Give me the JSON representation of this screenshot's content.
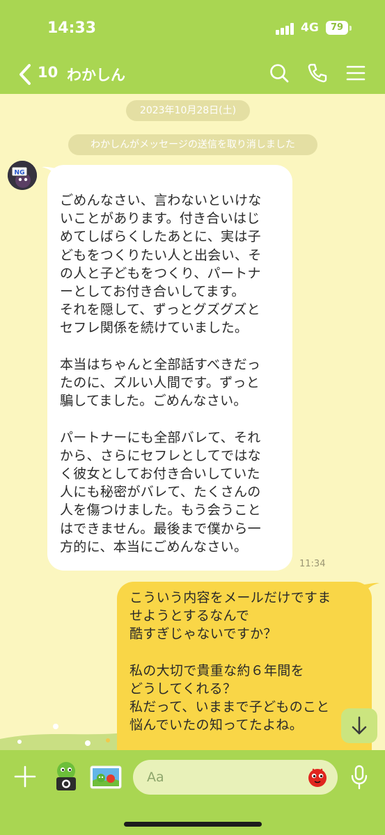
{
  "status_bar": {
    "time": "14:33",
    "network": "4G",
    "battery": "79"
  },
  "header": {
    "back_count": "10",
    "title": "わかしん"
  },
  "system_messages": {
    "date": "2023年10月28日(土)",
    "unsend_notice": "わかしんがメッセージの送信を取り消しました"
  },
  "incoming_message": {
    "avatar_badge": "NG",
    "paragraphs": [
      "ごめんなさい、言わないといけな\nいことがあります。付き合いはじ\nめてしばらくしたあとに、実は子\nどもをつくりたい人と出会い、そ\nの人と子どもをつくり、パートナ\nーとしてお付き合いしてます。\nそれを隠して、ずっとグズグズと\nセフレ関係を続けていました。",
      "本当はちゃんと全部話すべきだっ\nたのに、ズルい人間です。ずっと\n騙してました。ごめんなさい。",
      "パートナーにも全部バレて、それ\nから、さらにセフレとしてではな\nく彼女としてお付き合いしていた\n人にも秘密がバレて、たくさんの\n人を傷つけました。もう会うこと\nはできません。最後まで僕から一\n方的に、本当にごめんなさい。"
    ],
    "time": "11:34"
  },
  "outgoing_message": {
    "paragraphs": [
      "こういう内容をメールだけですま\nせようとするなんで\n酷すぎじゃないですか？",
      "私の大切で貴重な約６年間を\nどうしてくれる？\n私だって、いままで子どものこと\n悩んでいたの知ってたよね。"
    ]
  },
  "input_bar": {
    "placeholder": "Aa"
  },
  "colors": {
    "header_green": "#a9d652",
    "chat_background": "#fbf6bf",
    "incoming_bubble": "#ffffff",
    "outgoing_bubble": "#f9d647",
    "system_pill": "#e4dfa3"
  },
  "icons": [
    "back-chevron-icon",
    "search-icon",
    "phone-icon",
    "menu-icon",
    "plus-icon",
    "camera-icon",
    "photo-icon",
    "sticker-icon",
    "microphone-icon",
    "arrow-down-icon"
  ]
}
